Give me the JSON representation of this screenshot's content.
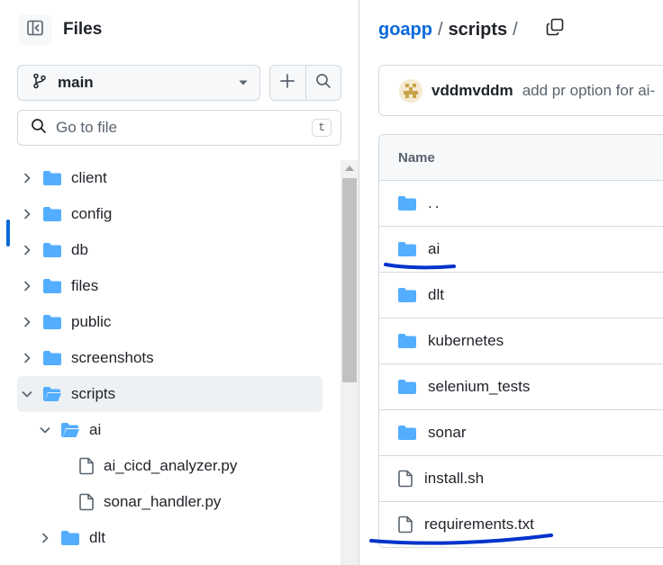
{
  "sidebar": {
    "title": "Files",
    "branch": "main",
    "search_placeholder": "Go to file",
    "search_shortcut": "t",
    "tree": [
      {
        "label": "client",
        "type": "folder",
        "expanded": false
      },
      {
        "label": "config",
        "type": "folder",
        "expanded": false
      },
      {
        "label": "db",
        "type": "folder",
        "expanded": false
      },
      {
        "label": "files",
        "type": "folder",
        "expanded": false
      },
      {
        "label": "public",
        "type": "folder",
        "expanded": false
      },
      {
        "label": "screenshots",
        "type": "folder",
        "expanded": false
      },
      {
        "label": "scripts",
        "type": "folder",
        "expanded": true,
        "selected": true
      },
      {
        "label": "ai",
        "type": "folder",
        "expanded": true
      },
      {
        "label": "ai_cicd_analyzer.py",
        "type": "file"
      },
      {
        "label": "sonar_handler.py",
        "type": "file"
      },
      {
        "label": "dlt",
        "type": "folder",
        "expanded": false
      }
    ]
  },
  "main": {
    "breadcrumb": {
      "repo": "goapp",
      "separator": "/",
      "current": "scripts",
      "trailing": "/"
    },
    "commit": {
      "author": "vddmvddm",
      "message": "add pr option for ai-"
    },
    "table_header": "Name",
    "rows": [
      {
        "name": "..",
        "type": "folder"
      },
      {
        "name": "ai",
        "type": "folder"
      },
      {
        "name": "dlt",
        "type": "folder"
      },
      {
        "name": "kubernetes",
        "type": "folder"
      },
      {
        "name": "selenium_tests",
        "type": "folder"
      },
      {
        "name": "sonar",
        "type": "folder"
      },
      {
        "name": "install.sh",
        "type": "file"
      },
      {
        "name": "requirements.txt",
        "type": "file"
      }
    ]
  },
  "colors": {
    "accent": "#0969da",
    "folder": "#54aeff",
    "annotation": "#0033cc"
  },
  "icons": {
    "sidebar_toggle": "sidebar-collapse-icon",
    "branch": "git-branch-icon",
    "dropdown": "triangle-down-icon",
    "add": "plus-icon",
    "search": "search-icon",
    "copy": "copy-icon",
    "folder": "folder-icon",
    "file": "file-icon"
  }
}
